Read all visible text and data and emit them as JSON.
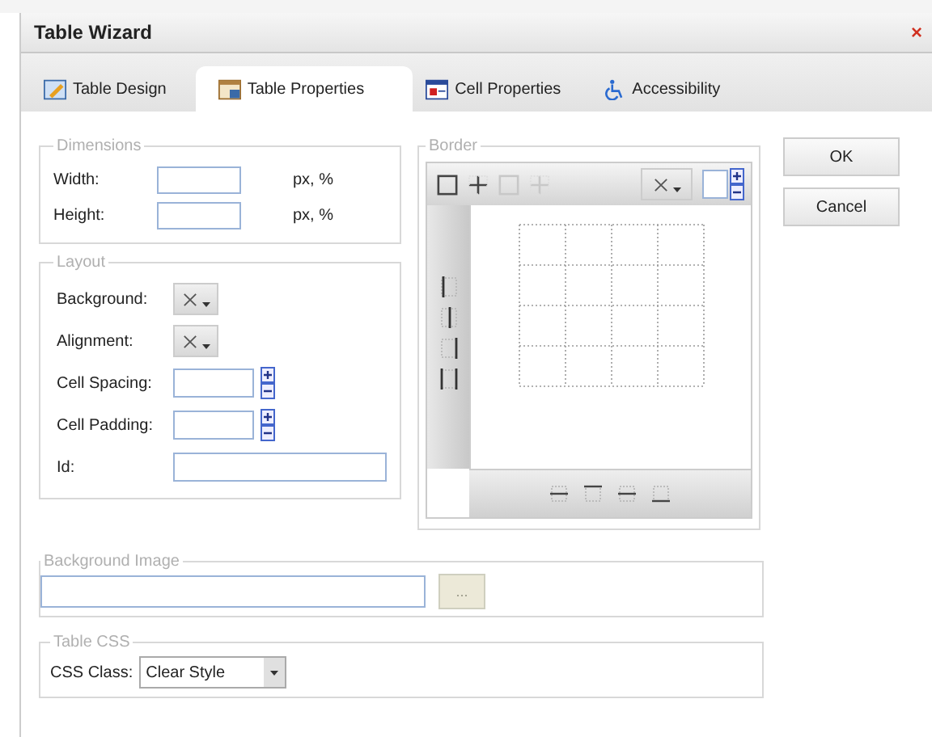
{
  "window": {
    "title": "Table Wizard",
    "close": "×"
  },
  "tabs": [
    {
      "kind": "design",
      "label": "Table Design",
      "selected": false
    },
    {
      "kind": "properties",
      "label": "Table Properties",
      "selected": true
    },
    {
      "kind": "cell",
      "label": "Cell Properties",
      "selected": false
    },
    {
      "kind": "accessibility",
      "label": "Accessibility",
      "selected": false
    }
  ],
  "dimensions": {
    "legend": "Dimensions",
    "fields": [
      {
        "label": "Width:",
        "unit": "px, %"
      },
      {
        "label": "Height:",
        "unit": "px, %"
      }
    ]
  },
  "layout": {
    "legend": "Layout",
    "rows": [
      {
        "kind": "picker",
        "label": "Background:"
      },
      {
        "kind": "picker",
        "label": "Alignment:"
      },
      {
        "kind": "spin",
        "label": "Cell Spacing:"
      },
      {
        "kind": "spin",
        "label": "Cell Padding:"
      },
      {
        "kind": "text",
        "label": "Id:"
      }
    ]
  },
  "border": {
    "legend": "Border",
    "tools": [
      {
        "kind": "outer",
        "disabled": false
      },
      {
        "kind": "inner",
        "disabled": false
      },
      {
        "kind": "outer",
        "disabled": true
      },
      {
        "kind": "inner",
        "disabled": true
      }
    ]
  },
  "buttons": [
    "OK",
    "Cancel"
  ],
  "background_image": {
    "legend": "Background Image",
    "browse": "..."
  },
  "table_css": {
    "legend": "Table CSS",
    "label": "CSS Class:",
    "value": "Clear Style"
  }
}
